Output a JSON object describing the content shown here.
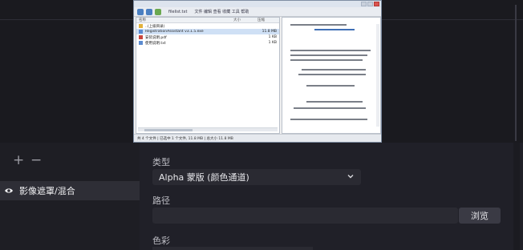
{
  "preview": {
    "window_tab": "filelist.txt",
    "toolbar_text": "文件 编辑 查看 收藏 工具 帮助",
    "columns": [
      "名称",
      "大小",
      "压缩"
    ],
    "files": [
      {
        "name": "..(上级目录)",
        "size": "",
        "selected": false,
        "icon": "folder-icon"
      },
      {
        "name": "RegistrationAssistant v3.1.5.exe",
        "size": "11.8 MB",
        "selected": true,
        "icon": "exe-icon"
      },
      {
        "name": "安装说明.pdf",
        "size": "1 KB",
        "selected": false,
        "icon": "pdf-icon"
      },
      {
        "name": "使用说明.txt",
        "size": "1 KB",
        "selected": false,
        "icon": "txt-icon"
      }
    ],
    "status": "共 4 个文件 | 已选中 1 个文件, 11.8 MB | 总大小 11.8 MB"
  },
  "left_panel": {
    "add_symbol": "+",
    "remove_symbol": "−",
    "filter_item": "影像遮罩/混合"
  },
  "properties": {
    "type_label": "类型",
    "type_value": "Alpha 蒙版 (颜色通道)",
    "path_label": "路径",
    "path_value": "",
    "browse_label": "浏览",
    "color_label": "色彩"
  }
}
